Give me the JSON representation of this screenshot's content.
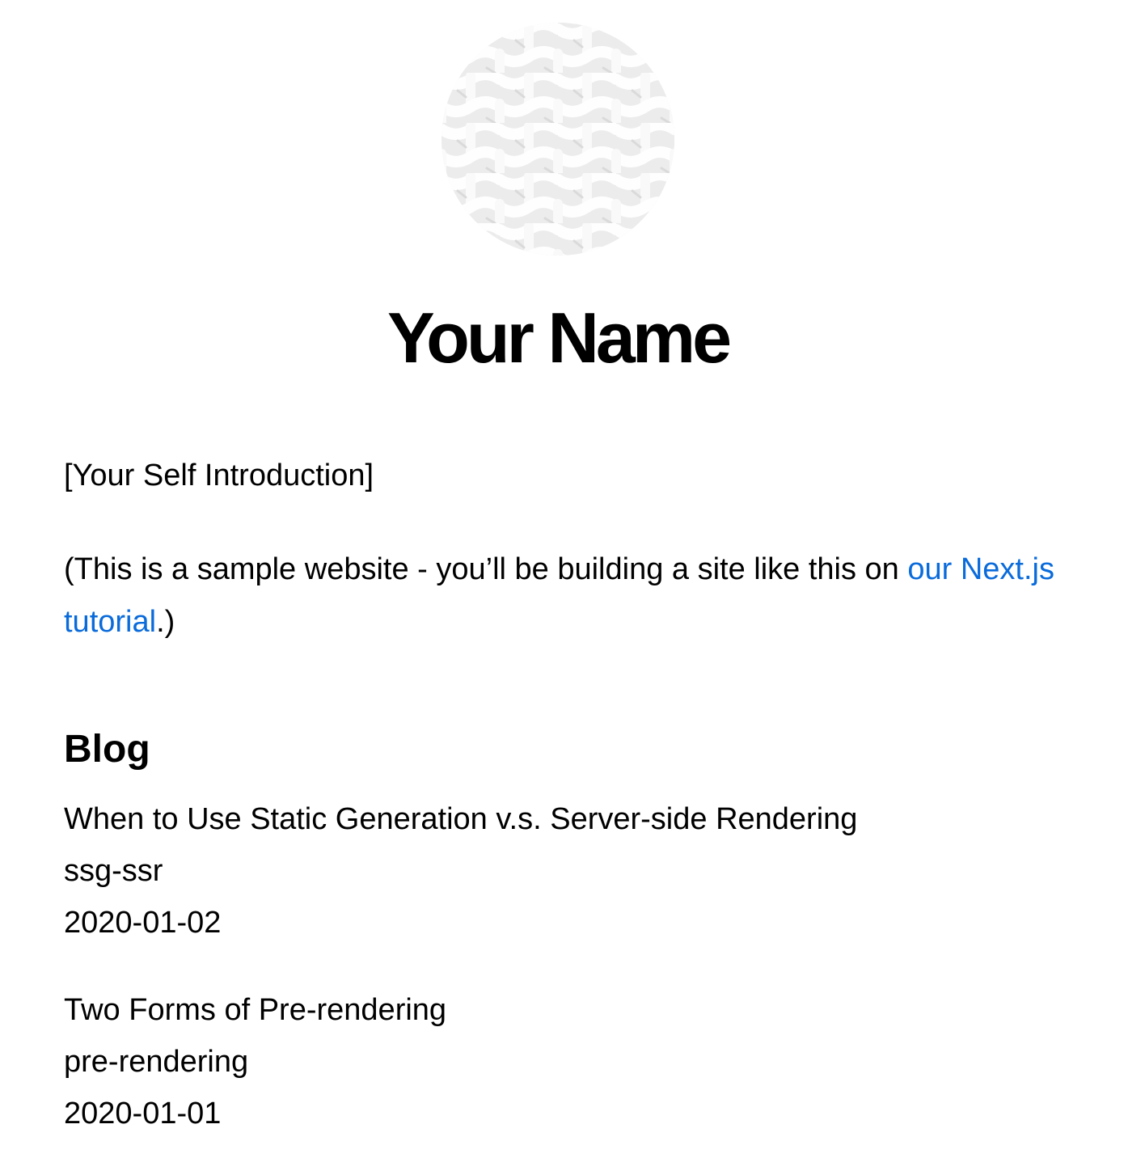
{
  "header": {
    "avatar_icon": "woven-pattern-avatar",
    "name": "Your Name"
  },
  "intro": {
    "self_intro": "[Your Self Introduction]",
    "note_prefix": "(This is a sample website - you’ll be building a site like this on ",
    "note_link": "our Next.js tutorial",
    "note_suffix": ".)"
  },
  "blog": {
    "heading": "Blog",
    "posts": [
      {
        "title": "When to Use Static Generation v.s. Server-side Rendering",
        "id": "ssg-ssr",
        "date": "2020-01-02"
      },
      {
        "title": "Two Forms of Pre-rendering",
        "id": "pre-rendering",
        "date": "2020-01-01"
      }
    ]
  },
  "colors": {
    "link": "#0a6bdb",
    "text": "#000000",
    "background": "#ffffff"
  }
}
